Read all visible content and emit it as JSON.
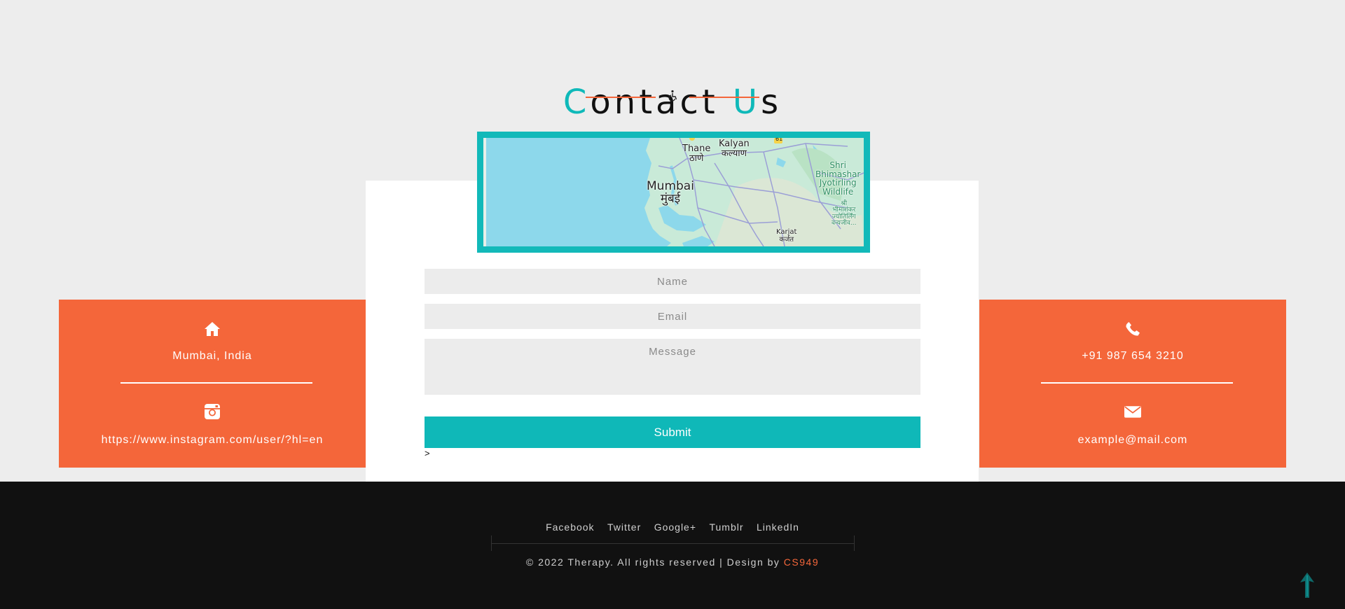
{
  "section": {
    "title_accent_1": "C",
    "title_rest_1": "ontact ",
    "title_accent_2": "U",
    "title_rest_2": "s",
    "title_icon": "wheelchair-icon"
  },
  "map": {
    "labels": {
      "thane_en": "Thane",
      "thane_hi": "ठाणे",
      "kalyan_en": "Kalyan",
      "kalyan_hi": "कल्याण",
      "mumbai_en": "Mumbai",
      "mumbai_hi": "मुंबई",
      "shri_en": "Shri\nBhimashar\nJyotirling\nWildlife",
      "shri_hi": "श्री\nभीमाशंकर\nज्योतिर्लिंग\nवन्यजीव...",
      "karjat_en": "Karjat",
      "karjat_hi": "कर्जत",
      "highway_1": "61"
    },
    "colors": {
      "water": "#8dd8eb",
      "land": "#c9ead8",
      "roads": "#9b9fd6"
    }
  },
  "form": {
    "name_placeholder": "Name",
    "email_placeholder": "Email",
    "message_placeholder": "Message",
    "submit_label": "Submit",
    "stray_text": ">"
  },
  "info_left": {
    "top_icon": "home-icon",
    "top_text": "Mumbai, India",
    "bottom_icon": "instagram-icon",
    "bottom_text": "https://www.instagram.com/user/?hl=en"
  },
  "info_right": {
    "top_icon": "phone-icon",
    "top_text": "+91 987 654 3210",
    "bottom_icon": "envelope-icon",
    "bottom_text": "example@mail.com"
  },
  "footer": {
    "links": [
      "Facebook",
      "Twitter",
      "Google+",
      "Tumblr",
      "LinkedIn"
    ],
    "copyright_prefix": "© 2022 Therapy. All rights reserved | Design by ",
    "brand": "CS949",
    "scroll_icon": "arrow-up-icon"
  },
  "colors": {
    "accent_teal": "#0fb9b9",
    "accent_orange": "#f4663a",
    "footer_bg": "#111111",
    "page_bg": "#ededed"
  }
}
